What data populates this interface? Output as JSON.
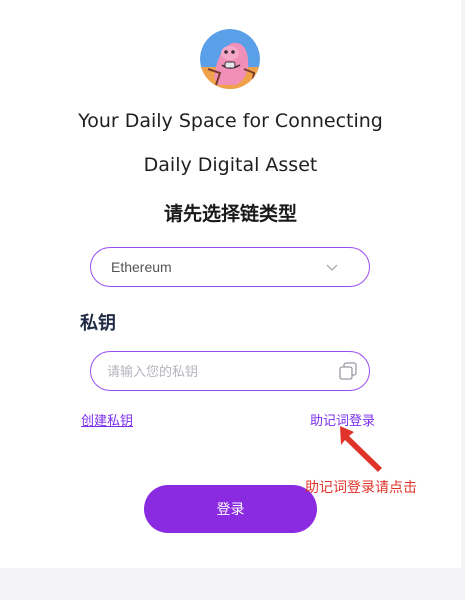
{
  "header": {
    "tagline_line1": "Your Daily Space for Connecting",
    "tagline_line2": "Daily Digital Asset",
    "select_chain_heading": "请先选择链类型"
  },
  "chain_select": {
    "selected": "Ethereum",
    "icon": "chevron-down-icon"
  },
  "private_key": {
    "label": "私钥",
    "placeholder": "请输入您的私钥",
    "value": "",
    "icon": "copy-icon"
  },
  "links": {
    "create_private_key": "创建私钥",
    "mnemonic_login": "助记词登录"
  },
  "annotation": {
    "hint": "助记词登录请点击",
    "color": "#e0342b"
  },
  "actions": {
    "login_label": "登录"
  },
  "colors": {
    "accent": "#8a2be2",
    "border": "#9b4ef0",
    "link": "#7b2ff0"
  }
}
